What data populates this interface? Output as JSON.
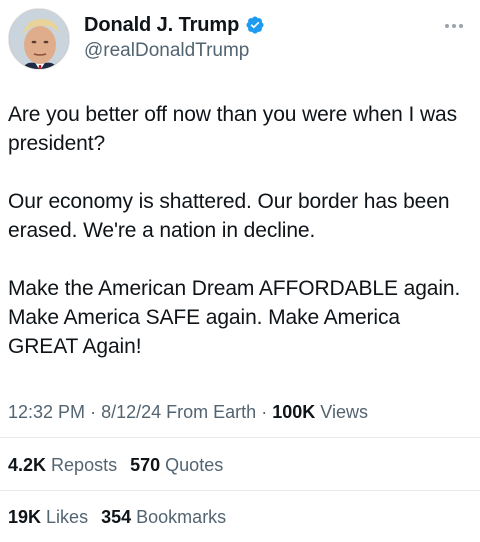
{
  "author": {
    "display_name": "Donald J. Trump",
    "handle": "@realDonaldTrump",
    "verified": true,
    "verified_color": "#1d9bf0"
  },
  "tweet": {
    "paragraphs": [
      "Are you better off now than you were when I was president?",
      "Our economy is shattered. Our border has been erased. We're a nation in decline.",
      "Make the American Dream AFFORDABLE again. Make America SAFE again. Make America GREAT Again!"
    ]
  },
  "meta": {
    "time": "12:32 PM",
    "separator": "·",
    "date": "8/12/24",
    "source": "From Earth",
    "views_count": "100K",
    "views_label": "Views"
  },
  "engagement": {
    "reposts_count": "4.2K",
    "reposts_label": "Reposts",
    "quotes_count": "570",
    "quotes_label": "Quotes",
    "likes_count": "19K",
    "likes_label": "Likes",
    "bookmarks_count": "354",
    "bookmarks_label": "Bookmarks"
  },
  "icons": {
    "verified": "verified-badge-icon",
    "more": "more-options-icon"
  }
}
